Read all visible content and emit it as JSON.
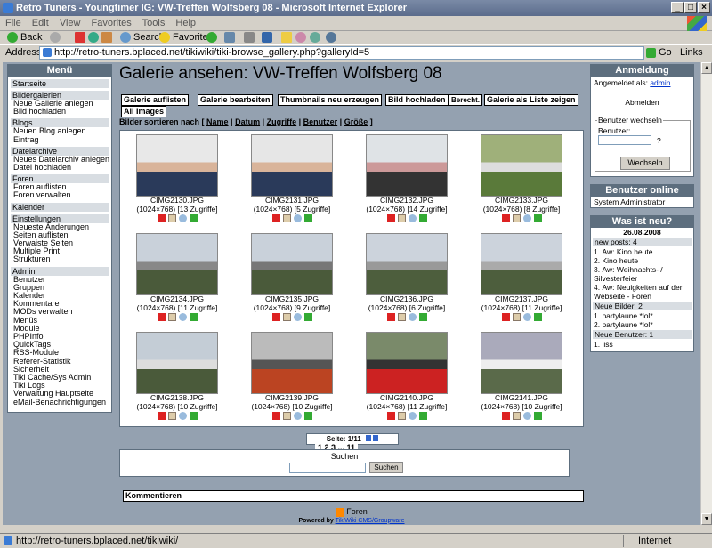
{
  "window": {
    "title": "Retro Tuners - Youngtimer IG: VW-Treffen Wolfsberg 08 - Microsoft Internet Explorer"
  },
  "menubar": [
    "File",
    "Edit",
    "View",
    "Favorites",
    "Tools",
    "Help"
  ],
  "toolbar": {
    "back": "Back",
    "search": "Search",
    "favorites": "Favorites"
  },
  "address": {
    "label": "Address",
    "url": "http://retro-tuners.bplaced.net/tikiwiki/tiki-browse_gallery.php?galleryId=5",
    "go": "Go",
    "links": "Links"
  },
  "status": {
    "text": "http://retro-tuners.bplaced.net/tikiwiki/",
    "zone": "Internet"
  },
  "leftmenu": {
    "title": "Menü",
    "sections": [
      {
        "header": "Startseite",
        "items": []
      },
      {
        "header": "Bildergalerien",
        "items": [
          "Neue Gallerie anlegen",
          "Bild hochladen"
        ]
      },
      {
        "header": "Blogs",
        "items": [
          "Neuen Blog anlegen",
          "Eintrag"
        ]
      },
      {
        "header": "Dateiarchive",
        "items": [
          "Neues Dateiarchiv anlegen",
          "Datei hochladen"
        ]
      },
      {
        "header": "Foren",
        "items": [
          "Foren auflisten",
          "Foren verwalten"
        ]
      },
      {
        "header": "Kalender",
        "items": []
      },
      {
        "header": "Einstellungen",
        "items": [
          "Neueste Änderungen",
          "Seiten auflisten",
          "Verwaiste Seiten",
          "Multiple Print",
          "Strukturen"
        ]
      },
      {
        "header": "Admin",
        "items": [
          "Benutzer",
          "Gruppen",
          "Kalender",
          "Kommentare",
          "MODs verwalten",
          "Menüs",
          "Module",
          "PHPInfo",
          "QuickTags",
          "RSS-Module",
          "Referer-Statistik",
          "Sicherheit",
          "Tiki Cache/Sys Admin",
          "Tiki Logs",
          "Verwaltung Hauptseite",
          "eMail-Benachrichtigungen"
        ]
      }
    ]
  },
  "page": {
    "title": "Galerie ansehen: VW-Treffen Wolfsberg 08",
    "buttons": [
      "Galerie auflisten",
      "Galerie bearbeiten",
      "Thumbnails neu erzeugen",
      "Bild hochladen",
      "Berecht.",
      "Galerie als Liste zeigen",
      "All Images"
    ],
    "sort_label": "Bilder sortieren nach",
    "sort_links": [
      "Name",
      "Datum",
      "Zugriffe",
      "Benutzer",
      "Größe"
    ]
  },
  "gallery": [
    {
      "name": "CIMG2130.JPG",
      "info": "(1024×768) [13 Zugriffe]",
      "palette": [
        "#e8e8e8",
        "#2a3a5a",
        "#d9b49a"
      ]
    },
    {
      "name": "CIMG2131.JPG",
      "info": "(1024×768) [5 Zugriffe]",
      "palette": [
        "#e6e6e6",
        "#2a3a5a",
        "#d9b49a"
      ]
    },
    {
      "name": "CIMG2132.JPG",
      "info": "(1024×768) [14 Zugriffe]",
      "palette": [
        "#dfe3e6",
        "#333",
        "#c99"
      ]
    },
    {
      "name": "CIMG2133.JPG",
      "info": "(1024×768) [8 Zugriffe]",
      "palette": [
        "#9fb07a",
        "#5a7a3a",
        "#ddd"
      ]
    },
    {
      "name": "CIMG2134.JPG",
      "info": "(1024×768) [11 Zugriffe]",
      "palette": [
        "#c9d1da",
        "#4a5a3a",
        "#888"
      ]
    },
    {
      "name": "CIMG2135.JPG",
      "info": "(1024×768) [9 Zugriffe]",
      "palette": [
        "#c9d1da",
        "#4a5a3a",
        "#777"
      ]
    },
    {
      "name": "CIMG2136.JPG",
      "info": "(1024×768) [6 Zugriffe]",
      "palette": [
        "#ccd3dc",
        "#4d5e3d",
        "#999"
      ]
    },
    {
      "name": "CIMG2137.JPG",
      "info": "(1024×768) [11 Zugriffe]",
      "palette": [
        "#ccd3dc",
        "#4d5e3d",
        "#aaa"
      ]
    },
    {
      "name": "CIMG2138.JPG",
      "info": "(1024×768) [10 Zugriffe]",
      "palette": [
        "#c4cdd6",
        "#4a5a3a",
        "#ddd"
      ]
    },
    {
      "name": "CIMG2139.JPG",
      "info": "(1024×768) [10 Zugriffe]",
      "palette": [
        "#bbb",
        "#b42",
        "#555"
      ]
    },
    {
      "name": "CIMG2140.JPG",
      "info": "(1024×768) [11 Zugriffe]",
      "palette": [
        "#7a8a6a",
        "#c22",
        "#333"
      ]
    },
    {
      "name": "CIMG2141.JPG",
      "info": "(1024×768) [10 Zugriffe]",
      "palette": [
        "#aab",
        "#5a6a4a",
        "#eee"
      ]
    }
  ],
  "pager": {
    "label": "Seite: 1/11",
    "pages": "1 2 3 ... 11"
  },
  "search": {
    "title": "Suchen",
    "button": "Suchen"
  },
  "comments": {
    "label": "Kommentieren"
  },
  "footer": {
    "forum": "Foren",
    "powered_prefix": "Powered by",
    "powered_link": "TikiWiki CMS/Groupware"
  },
  "right": {
    "login": {
      "title": "Anmeldung",
      "logged_as": "Angemeldet als:",
      "user": "admin",
      "logout": "Abmelden",
      "switch_legend": "Benutzer wechseln",
      "user_label": "Benutzer:",
      "q": "?",
      "switch_button": "Wechseln"
    },
    "online": {
      "title": "Benutzer online",
      "users": [
        "System Administrator"
      ]
    },
    "news": {
      "title": "Was ist neu?",
      "date": "26.08.2008",
      "posts_header": "new posts: 4",
      "posts": [
        "Aw: Kino heute",
        "Kino heute",
        "Aw: Weihnachts- / Silvesterfeier",
        "Aw: Neuigkeiten auf der Webseite - Foren"
      ],
      "images_header": "Neue Bilder: 2",
      "images": [
        "partylaune *lol*",
        "partylaune *lol*"
      ],
      "users_header": "Neue Benutzer: 1",
      "users": [
        "liss"
      ]
    }
  },
  "colors": {
    "page_bg": "#94a1b0",
    "box_header": "#5d6e7e",
    "accent_link": "#0033cc"
  }
}
